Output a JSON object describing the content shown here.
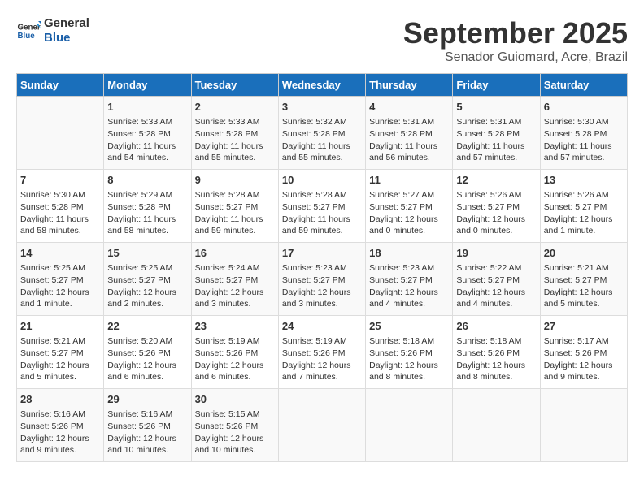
{
  "header": {
    "logo_line1": "General",
    "logo_line2": "Blue",
    "title": "September 2025",
    "subtitle": "Senador Guiomard, Acre, Brazil"
  },
  "columns": [
    "Sunday",
    "Monday",
    "Tuesday",
    "Wednesday",
    "Thursday",
    "Friday",
    "Saturday"
  ],
  "weeks": [
    {
      "days": [
        {
          "num": "",
          "info": ""
        },
        {
          "num": "1",
          "info": "Sunrise: 5:33 AM\nSunset: 5:28 PM\nDaylight: 11 hours\nand 54 minutes."
        },
        {
          "num": "2",
          "info": "Sunrise: 5:33 AM\nSunset: 5:28 PM\nDaylight: 11 hours\nand 55 minutes."
        },
        {
          "num": "3",
          "info": "Sunrise: 5:32 AM\nSunset: 5:28 PM\nDaylight: 11 hours\nand 55 minutes."
        },
        {
          "num": "4",
          "info": "Sunrise: 5:31 AM\nSunset: 5:28 PM\nDaylight: 11 hours\nand 56 minutes."
        },
        {
          "num": "5",
          "info": "Sunrise: 5:31 AM\nSunset: 5:28 PM\nDaylight: 11 hours\nand 57 minutes."
        },
        {
          "num": "6",
          "info": "Sunrise: 5:30 AM\nSunset: 5:28 PM\nDaylight: 11 hours\nand 57 minutes."
        }
      ]
    },
    {
      "days": [
        {
          "num": "7",
          "info": "Sunrise: 5:30 AM\nSunset: 5:28 PM\nDaylight: 11 hours\nand 58 minutes."
        },
        {
          "num": "8",
          "info": "Sunrise: 5:29 AM\nSunset: 5:28 PM\nDaylight: 11 hours\nand 58 minutes."
        },
        {
          "num": "9",
          "info": "Sunrise: 5:28 AM\nSunset: 5:27 PM\nDaylight: 11 hours\nand 59 minutes."
        },
        {
          "num": "10",
          "info": "Sunrise: 5:28 AM\nSunset: 5:27 PM\nDaylight: 11 hours\nand 59 minutes."
        },
        {
          "num": "11",
          "info": "Sunrise: 5:27 AM\nSunset: 5:27 PM\nDaylight: 12 hours\nand 0 minutes."
        },
        {
          "num": "12",
          "info": "Sunrise: 5:26 AM\nSunset: 5:27 PM\nDaylight: 12 hours\nand 0 minutes."
        },
        {
          "num": "13",
          "info": "Sunrise: 5:26 AM\nSunset: 5:27 PM\nDaylight: 12 hours\nand 1 minute."
        }
      ]
    },
    {
      "days": [
        {
          "num": "14",
          "info": "Sunrise: 5:25 AM\nSunset: 5:27 PM\nDaylight: 12 hours\nand 1 minute."
        },
        {
          "num": "15",
          "info": "Sunrise: 5:25 AM\nSunset: 5:27 PM\nDaylight: 12 hours\nand 2 minutes."
        },
        {
          "num": "16",
          "info": "Sunrise: 5:24 AM\nSunset: 5:27 PM\nDaylight: 12 hours\nand 3 minutes."
        },
        {
          "num": "17",
          "info": "Sunrise: 5:23 AM\nSunset: 5:27 PM\nDaylight: 12 hours\nand 3 minutes."
        },
        {
          "num": "18",
          "info": "Sunrise: 5:23 AM\nSunset: 5:27 PM\nDaylight: 12 hours\nand 4 minutes."
        },
        {
          "num": "19",
          "info": "Sunrise: 5:22 AM\nSunset: 5:27 PM\nDaylight: 12 hours\nand 4 minutes."
        },
        {
          "num": "20",
          "info": "Sunrise: 5:21 AM\nSunset: 5:27 PM\nDaylight: 12 hours\nand 5 minutes."
        }
      ]
    },
    {
      "days": [
        {
          "num": "21",
          "info": "Sunrise: 5:21 AM\nSunset: 5:27 PM\nDaylight: 12 hours\nand 5 minutes."
        },
        {
          "num": "22",
          "info": "Sunrise: 5:20 AM\nSunset: 5:26 PM\nDaylight: 12 hours\nand 6 minutes."
        },
        {
          "num": "23",
          "info": "Sunrise: 5:19 AM\nSunset: 5:26 PM\nDaylight: 12 hours\nand 6 minutes."
        },
        {
          "num": "24",
          "info": "Sunrise: 5:19 AM\nSunset: 5:26 PM\nDaylight: 12 hours\nand 7 minutes."
        },
        {
          "num": "25",
          "info": "Sunrise: 5:18 AM\nSunset: 5:26 PM\nDaylight: 12 hours\nand 8 minutes."
        },
        {
          "num": "26",
          "info": "Sunrise: 5:18 AM\nSunset: 5:26 PM\nDaylight: 12 hours\nand 8 minutes."
        },
        {
          "num": "27",
          "info": "Sunrise: 5:17 AM\nSunset: 5:26 PM\nDaylight: 12 hours\nand 9 minutes."
        }
      ]
    },
    {
      "days": [
        {
          "num": "28",
          "info": "Sunrise: 5:16 AM\nSunset: 5:26 PM\nDaylight: 12 hours\nand 9 minutes."
        },
        {
          "num": "29",
          "info": "Sunrise: 5:16 AM\nSunset: 5:26 PM\nDaylight: 12 hours\nand 10 minutes."
        },
        {
          "num": "30",
          "info": "Sunrise: 5:15 AM\nSunset: 5:26 PM\nDaylight: 12 hours\nand 10 minutes."
        },
        {
          "num": "",
          "info": ""
        },
        {
          "num": "",
          "info": ""
        },
        {
          "num": "",
          "info": ""
        },
        {
          "num": "",
          "info": ""
        }
      ]
    }
  ]
}
